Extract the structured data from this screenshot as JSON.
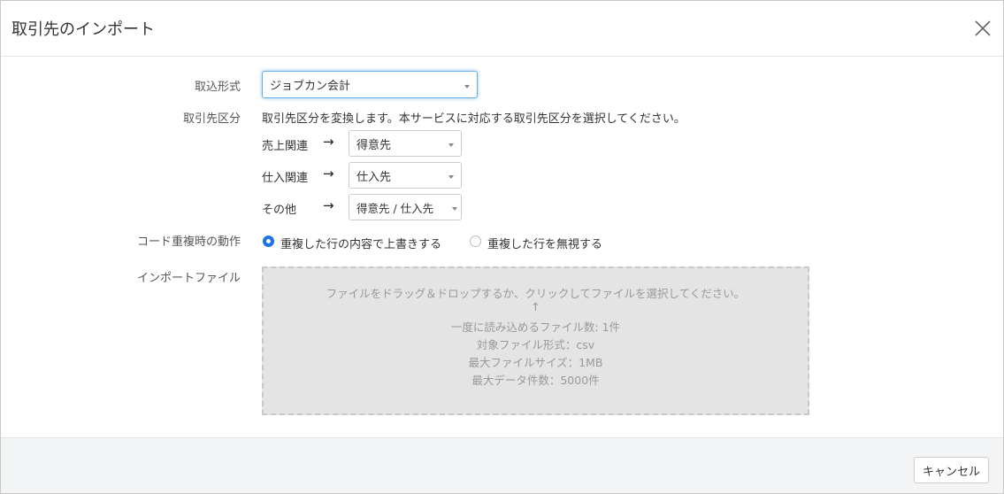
{
  "modal": {
    "title": "取引先のインポート",
    "close_icon": "close-icon"
  },
  "form": {
    "format": {
      "label": "取込形式",
      "value": "ジョブカン会計"
    },
    "partner_type": {
      "label": "取引先区分",
      "description": "取引先区分を変換します。本サービスに対応する取引先区分を選択してください。",
      "mappings": [
        {
          "source": "売上関連",
          "arrow": "→",
          "value": "得意先"
        },
        {
          "source": "仕入関連",
          "arrow": "→",
          "value": "仕入先"
        },
        {
          "source": "その他",
          "arrow": "→",
          "value": "得意先 / 仕入先"
        }
      ]
    },
    "duplicate_action": {
      "label": "コード重複時の動作",
      "options": [
        {
          "label": "重複した行の内容で上書きする",
          "checked": true
        },
        {
          "label": "重複した行を無視する",
          "checked": false
        }
      ]
    },
    "import_file": {
      "label": "インポートファイル",
      "dropzone": {
        "instruction": "ファイルをドラッグ＆ドロップするか、クリックしてファイルを選択してください。",
        "arrow": "↑",
        "max_files": "一度に読み込めるファイル数: 1件",
        "file_format": "対象ファイル形式：csv",
        "max_size": "最大ファイルサイズ：1MB",
        "max_rows": "最大データ件数：5000件"
      }
    }
  },
  "footer": {
    "cancel_label": "キャンセル"
  },
  "colors": {
    "accent": "#1a73e8",
    "footer_bg": "#f3f4f6",
    "dropzone_bg": "#e4e4e4"
  }
}
